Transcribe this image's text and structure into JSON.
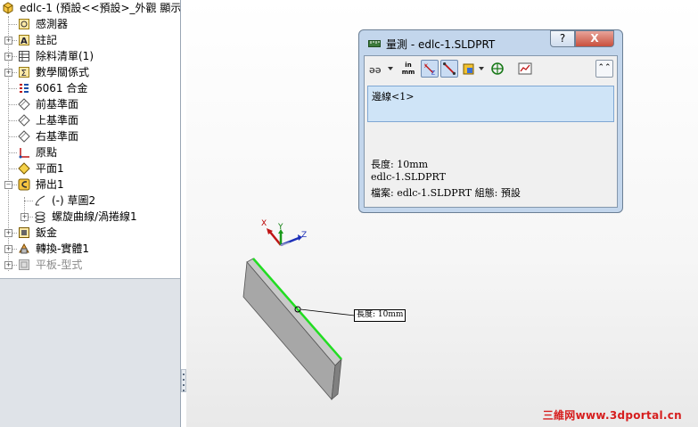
{
  "tree": {
    "root": {
      "label": "edlc-1  (預設<<預設>_外觀 顯示",
      "icon": "part-icon"
    },
    "items": [
      {
        "label": "感測器",
        "icon": "sensor-icon",
        "expander": false
      },
      {
        "label": "註記",
        "icon": "annotation-icon",
        "expander": true
      },
      {
        "label": "除料清單(1)",
        "icon": "cut-list-icon",
        "expander": true
      },
      {
        "label": "數學關係式",
        "icon": "equation-icon",
        "expander": true
      },
      {
        "label": "6061 合金",
        "icon": "material-icon",
        "expander": false
      },
      {
        "label": "前基準面",
        "icon": "plane-icon",
        "expander": false
      },
      {
        "label": "上基準面",
        "icon": "plane-icon",
        "expander": false
      },
      {
        "label": "右基準面",
        "icon": "plane-icon",
        "expander": false
      },
      {
        "label": "原點",
        "icon": "origin-icon",
        "expander": false
      },
      {
        "label": "平面1",
        "icon": "plane-yellow-icon",
        "expander": false
      },
      {
        "label": "掃出1",
        "icon": "sweep-icon",
        "expander": true,
        "expanded": true
      },
      {
        "label": "(-) 草圖2",
        "icon": "sketch-icon",
        "expander": false,
        "child": true
      },
      {
        "label": "螺旋曲線/渦捲線1",
        "icon": "helix-icon",
        "expander": true,
        "child": true
      },
      {
        "label": "鈑金",
        "icon": "sheet-metal-icon",
        "expander": true
      },
      {
        "label": "轉換-實體1",
        "icon": "convert-solid-icon",
        "expander": true
      },
      {
        "label": "平板-型式",
        "icon": "flat-pattern-icon",
        "expander": true,
        "dimmed": true
      }
    ]
  },
  "dialog": {
    "title": "量測 - edlc-1.SLDPRT",
    "help_label": "?",
    "close_label": "X",
    "toolbar": {
      "units_label_top": "in",
      "units_label_bottom": "mm",
      "icons": [
        "arc-circle-measure-icon",
        "units-icon",
        "xyz-measure-icon",
        "point-to-point-icon",
        "projection-icon",
        "center-of-mass-icon",
        "history-icon",
        "collapse-icon"
      ]
    },
    "selection": "邊線<1>",
    "results": [
      "長度: 10mm",
      "edlc-1.SLDPRT",
      "檔案: edlc-1.SLDPRT 組態: 預設"
    ]
  },
  "viewport": {
    "triad": {
      "x_label": "X",
      "y_label": "Y",
      "z_label": "Z"
    },
    "callout": "長度: 10mm",
    "highlight_color": "#22dd22"
  },
  "watermark": "三維网www.3dportal.cn"
}
